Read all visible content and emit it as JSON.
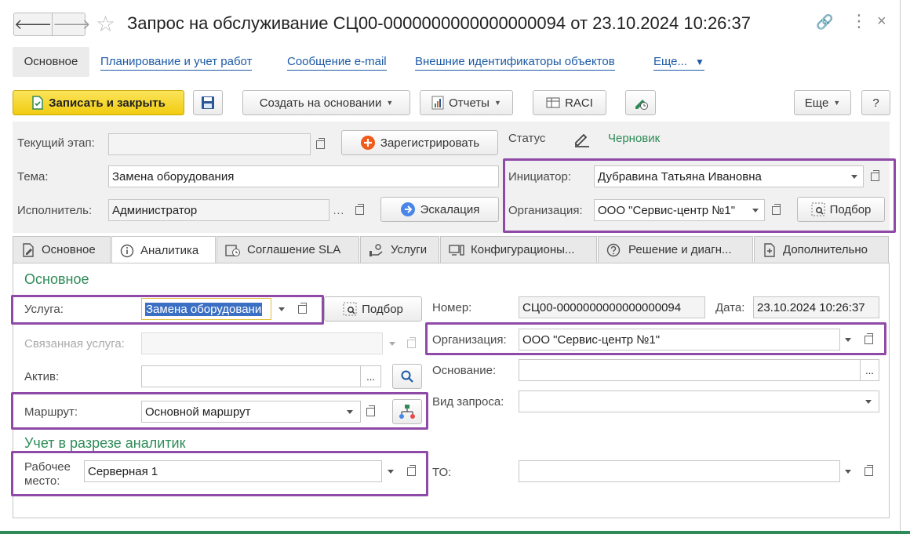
{
  "window": {
    "title": "Запрос на обслуживание СЦ00-0000000000000000094 от 23.10.2024 10:26:37",
    "nav_back": "🡐",
    "nav_forward": "🡒"
  },
  "top_tabs": [
    {
      "label": "Основное"
    },
    {
      "label": "Планирование и учет работ"
    },
    {
      "label": "Сообщение e-mail"
    },
    {
      "label": "Внешние идентификаторы объектов"
    },
    {
      "label": "Еще..."
    }
  ],
  "toolbar": {
    "save_close": "Записать и закрыть",
    "create_based": "Создать на основании",
    "reports": "Отчеты",
    "raci": "RACI",
    "more": "Еще",
    "help": "?"
  },
  "header": {
    "stage_label": "Текущий этап:",
    "stage_value": "",
    "register_button": "Зарегистрировать",
    "status_label": "Статус",
    "status_value": "Черновик",
    "topic_label": "Тема:",
    "topic_value": "Замена оборудования",
    "executor_label": "Исполнитель:",
    "executor_value": "Администратор",
    "escalation_button": "Эскалация",
    "initiator_label": "Инициатор:",
    "initiator_value": "Дубравина Татьяна Ивановна",
    "org_label": "Организация:",
    "org_value": "ООО \"Сервис-центр №1\"",
    "pick_button": "Подбор"
  },
  "form_tabs": [
    {
      "label": "Основное"
    },
    {
      "label": "Аналитика"
    },
    {
      "label": "Соглашение SLA"
    },
    {
      "label": "Услуги"
    },
    {
      "label": "Конфигурационы..."
    },
    {
      "label": "Решение и диагн..."
    },
    {
      "label": "Дополнительно"
    }
  ],
  "analytics": {
    "section_main": "Основное",
    "service_label": "Услуга:",
    "service_value": "Замена оборудовани",
    "pick_button": "Подбор",
    "related_label": "Связанная услуга:",
    "asset_label": "Актив:",
    "route_label": "Маршрут:",
    "route_value": "Основной маршрут",
    "section_analytics": "Учет в разрезе аналитик",
    "workplace_label": "Рабочее место:",
    "workplace_value": "Серверная 1",
    "number_label": "Номер:",
    "number_value": "СЦ00-0000000000000000094",
    "date_label": "Дата:",
    "date_value": "23.10.2024 10:26:37",
    "org_label": "Организация:",
    "org_value": "ООО \"Сервис-центр №1\"",
    "basis_label": "Основание:",
    "request_type_label": "Вид запроса:",
    "to_label": "ТО:"
  },
  "colors": {
    "accent": "#8e4aa6",
    "status_green": "#2e8b57",
    "link": "#1c5aa6",
    "primary_button": "#f1cc10"
  }
}
